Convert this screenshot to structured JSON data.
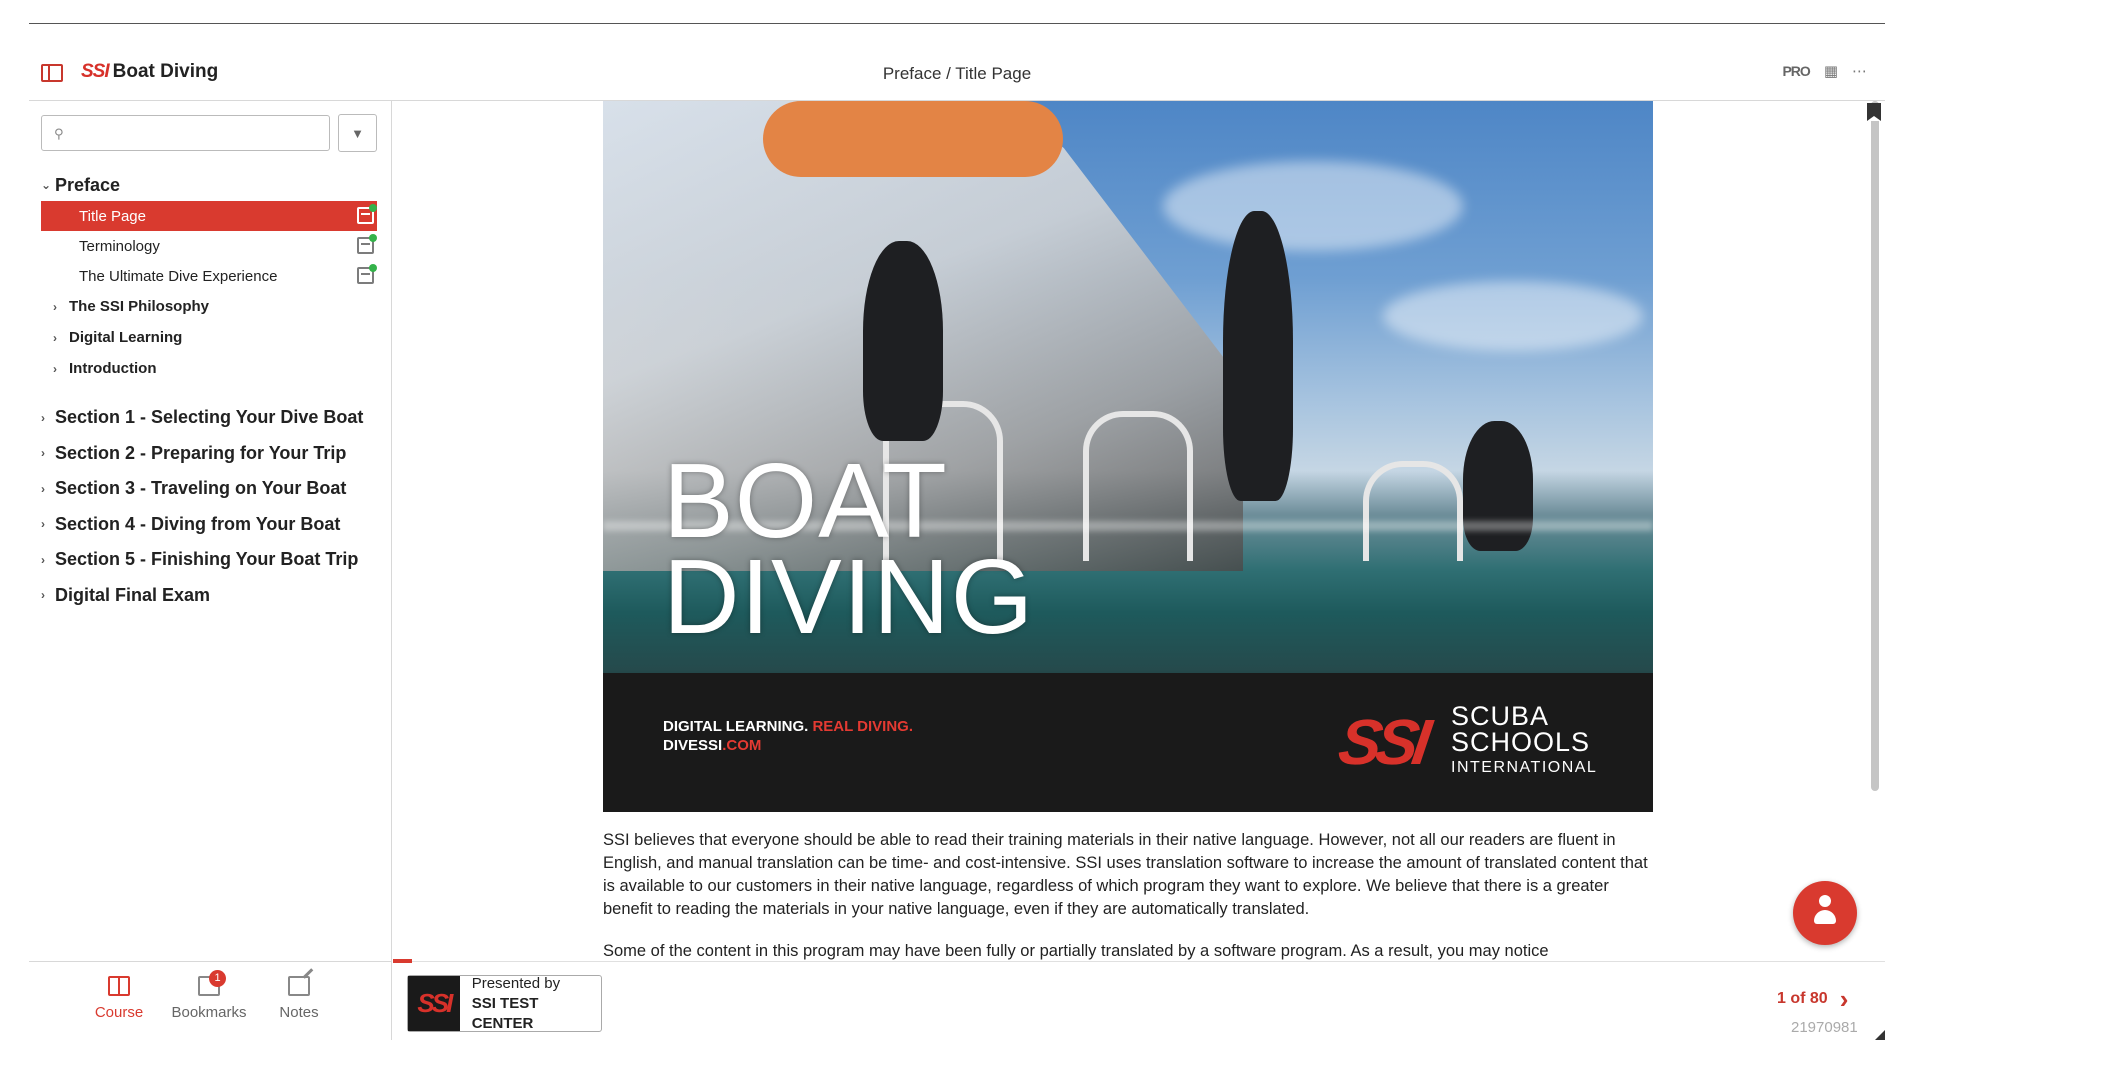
{
  "header": {
    "brand_logo": "SSI",
    "brand_title": "Boat Diving",
    "page_title": "Preface / Title Page",
    "pro_label": "PRO"
  },
  "sidebar": {
    "search": {
      "value": "",
      "placeholder": ""
    },
    "toc": {
      "preface": {
        "label": "Preface",
        "expanded": true
      },
      "preface_items": [
        {
          "label": "Title Page",
          "active": true
        },
        {
          "label": "Terminology",
          "active": false
        },
        {
          "label": "The Ultimate Dive Experience",
          "active": false
        }
      ],
      "preface_groups": [
        {
          "label": "The SSI Philosophy"
        },
        {
          "label": "Digital Learning"
        },
        {
          "label": "Introduction"
        }
      ],
      "sections": [
        {
          "label": "Section 1 - Selecting Your Dive Boat"
        },
        {
          "label": "Section 2 - Preparing for Your Trip"
        },
        {
          "label": "Section 3 - Traveling on Your Boat"
        },
        {
          "label": "Section 4 - Diving from Your Boat"
        },
        {
          "label": "Section 5 - Finishing Your Boat Trip"
        },
        {
          "label": "Digital Final Exam"
        }
      ]
    }
  },
  "bottom_nav": {
    "course": "Course",
    "bookmarks": "Bookmarks",
    "bookmarks_badge": "1",
    "notes": "Notes"
  },
  "cover": {
    "title_line1": "BOAT",
    "title_line2": "DIVING",
    "tagline_white": "DIGITAL LEARNING.",
    "tagline_red": "REAL DIVING.",
    "url_white": "DIVESSI",
    "url_red": ".COM",
    "logo_mark": "SSI",
    "org_line1": "SCUBA",
    "org_line2": "SCHOOLS",
    "org_line3": "INTERNATIONAL"
  },
  "body": {
    "paragraph1": "SSI believes that everyone should be able to read their training materials in their native language.  However, not all our readers are fluent in English, and manual translation can be time- and cost-intensive.  SSI uses translation software to increase the amount of translated content that is available to our customers in their native language, regardless of which program they want to explore.  We believe that there is a greater benefit to reading the materials in your native language, even if they are automatically translated.",
    "paragraph2": "Some of the content in this program may have been fully or partially translated by a software program.  As a result, you may notice"
  },
  "footer": {
    "presented_by": "Presented by",
    "center_name": "SSI TEST CENTER",
    "logo_mark": "SSI",
    "page_count": "1 of 80",
    "doc_id": "21970981",
    "progress_fraction": 0.0125
  },
  "colors": {
    "accent": "#d93a2f",
    "brand_red": "#d7312a"
  }
}
